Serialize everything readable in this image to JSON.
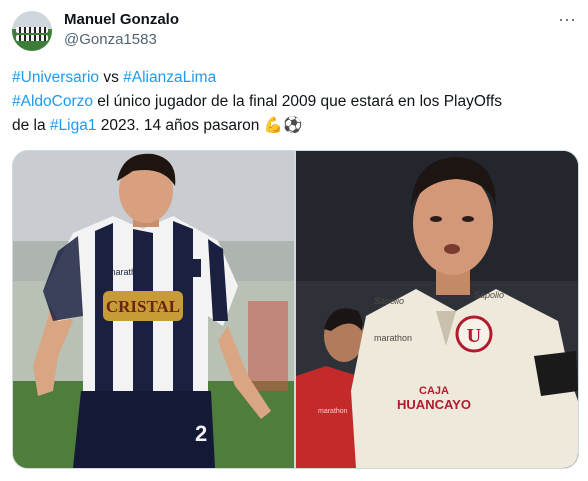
{
  "author": {
    "name": "Manuel Gonzalo",
    "handle": "@Gonza1583",
    "avatar_icon": "team-photo-avatar"
  },
  "more_icon": "more-dots-icon",
  "tweet": {
    "line1": {
      "tag1": "#Universario",
      "text": " vs ",
      "tag2": "#AlianzaLima"
    },
    "line2": {
      "tag": "#AldoCorzo",
      "text": " el único jugador de la final 2009 que estará en los PlayOffs"
    },
    "line3": {
      "pre": "de la ",
      "tag": "#Liga1",
      "text": " 2023. 14 años pasaron ",
      "emoji1": "💪",
      "emoji2": "⚽"
    }
  },
  "media": {
    "left_photo": {
      "shirt_sponsor": "CRISTAL",
      "shirt_brand": "marathon",
      "short_number": "2"
    },
    "right_photo": {
      "shirt_sponsor_line1": "CAJA",
      "shirt_sponsor_line2": "HUANCAYO",
      "shirt_brand": "marathon",
      "crest_letter": "U",
      "sleeve_sponsor": "Sapolio",
      "chest_sponsor": "Sapolio",
      "referee_brand": "marathon"
    }
  },
  "colors": {
    "hashtag": "#1d9bf0",
    "handle": "#536471",
    "alianza_navy": "#1a2140",
    "universitario_cream": "#efe9dc",
    "crest_red": "#b01c2e"
  }
}
